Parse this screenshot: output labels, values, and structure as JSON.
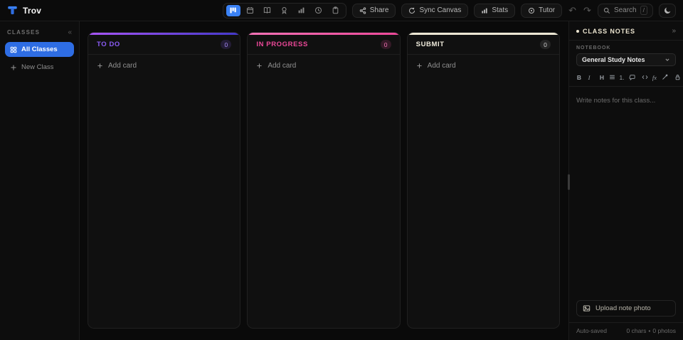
{
  "app": {
    "name": "Trov"
  },
  "topbar": {
    "view_icons": [
      "kanban",
      "calendar",
      "book",
      "award",
      "bar-chart",
      "clock",
      "clipboard"
    ],
    "buttons": {
      "share": "Share",
      "sync": "Sync Canvas",
      "stats": "Stats",
      "tutor": "Tutor"
    },
    "search": {
      "placeholder": "Search",
      "shortcut": "/"
    }
  },
  "sidebar": {
    "header": "CLASSES",
    "items": [
      {
        "label": "All Classes",
        "active": true
      },
      {
        "label": "New Class",
        "active": false
      }
    ]
  },
  "board": {
    "columns": [
      {
        "title": "TO DO",
        "count": "0",
        "add_label": "Add card",
        "accent": "#8b5cf6"
      },
      {
        "title": "IN PROGRESS",
        "count": "0",
        "add_label": "Add card",
        "accent": "#ec4899"
      },
      {
        "title": "SUBMIT",
        "count": "0",
        "add_label": "Add card",
        "accent": "#ece7d4"
      }
    ]
  },
  "notes_panel": {
    "title": "CLASS NOTES",
    "notebook": {
      "label": "NOTEBOOK",
      "selected": "General Study Notes"
    },
    "toolbar": {
      "bold": "B",
      "italic": "I",
      "heading": "H",
      "ordered_list": "1.",
      "formula": "fx"
    },
    "editor": {
      "placeholder": "Write notes for this class..."
    },
    "upload_label": "Upload note photo",
    "footer": {
      "autosave": "Auto-saved",
      "chars": "0 chars",
      "sep": "•",
      "photos": "0 photos"
    }
  },
  "colors": {
    "accent_blue": "#3b82f6",
    "todo_purple": "#8b5cf6",
    "progress_pink": "#ec4899",
    "submit_cream": "#ece7d4"
  }
}
